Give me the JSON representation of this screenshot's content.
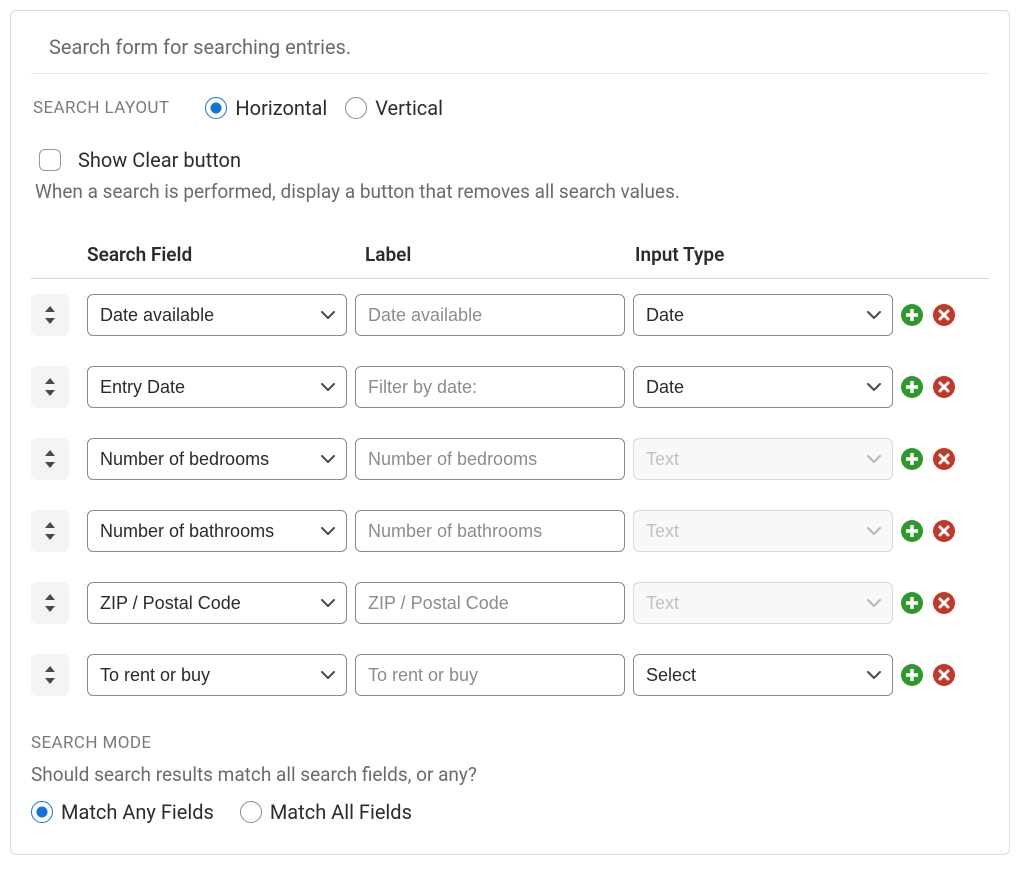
{
  "intro": "Search form for searching entries.",
  "layout": {
    "title": "SEARCH LAYOUT",
    "horizontal": "Horizontal",
    "vertical": "Vertical"
  },
  "clear": {
    "label": "Show Clear button",
    "help": "When a search is performed, display a button that removes all search values."
  },
  "table": {
    "headers": {
      "field": "Search Field",
      "label": "Label",
      "input": "Input Type"
    },
    "rows": [
      {
        "field": "Date available",
        "placeholder": "Date available",
        "type": "Date",
        "disabled": false
      },
      {
        "field": "Entry Date",
        "placeholder": "Filter by date:",
        "type": "Date",
        "disabled": false
      },
      {
        "field": "Number of bedrooms",
        "placeholder": "Number of bedrooms",
        "type": "Text",
        "disabled": true
      },
      {
        "field": "Number of bathrooms",
        "placeholder": "Number of bathrooms",
        "type": "Text",
        "disabled": true
      },
      {
        "field": "ZIP / Postal Code",
        "placeholder": "ZIP / Postal Code",
        "type": "Text",
        "disabled": true
      },
      {
        "field": "To rent or buy",
        "placeholder": "To rent or buy",
        "type": "Select",
        "disabled": false
      }
    ]
  },
  "mode": {
    "title": "SEARCH MODE",
    "help": "Should search results match all search fields, or any?",
    "any": "Match Any Fields",
    "all": "Match All Fields"
  }
}
